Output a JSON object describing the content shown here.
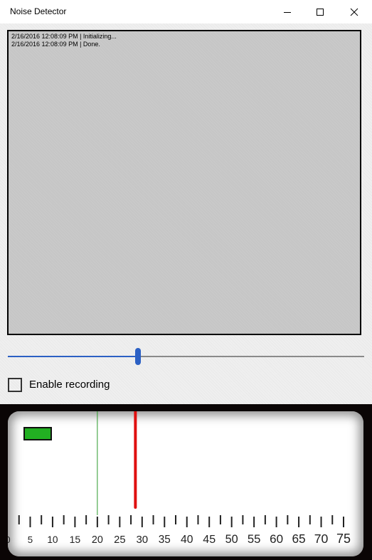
{
  "window": {
    "title": "Noise Detector",
    "buttons": [
      "minimize-icon",
      "maximize-icon",
      "close-icon"
    ]
  },
  "log": {
    "lines": [
      "2/16/2016 12:08:09 PM | Initializing...",
      "2/16/2016 12:08:09 PM | Done."
    ]
  },
  "slider": {
    "value_fraction": 0.365,
    "accent": "#2b60c4"
  },
  "recording": {
    "label": "Enable recording",
    "checked": false
  },
  "meter": {
    "indicator_color": "#22b022",
    "scale_min": 0,
    "scale_max": 75,
    "threshold_value": 20,
    "threshold_color": "#2a9a2a",
    "needle_value": 28.5,
    "needle_color": "#e01010",
    "tick_labels": [
      "0",
      "5",
      "10",
      "15",
      "20",
      "25",
      "30",
      "35",
      "40",
      "45",
      "50",
      "55",
      "60",
      "65",
      "70",
      "75"
    ]
  }
}
